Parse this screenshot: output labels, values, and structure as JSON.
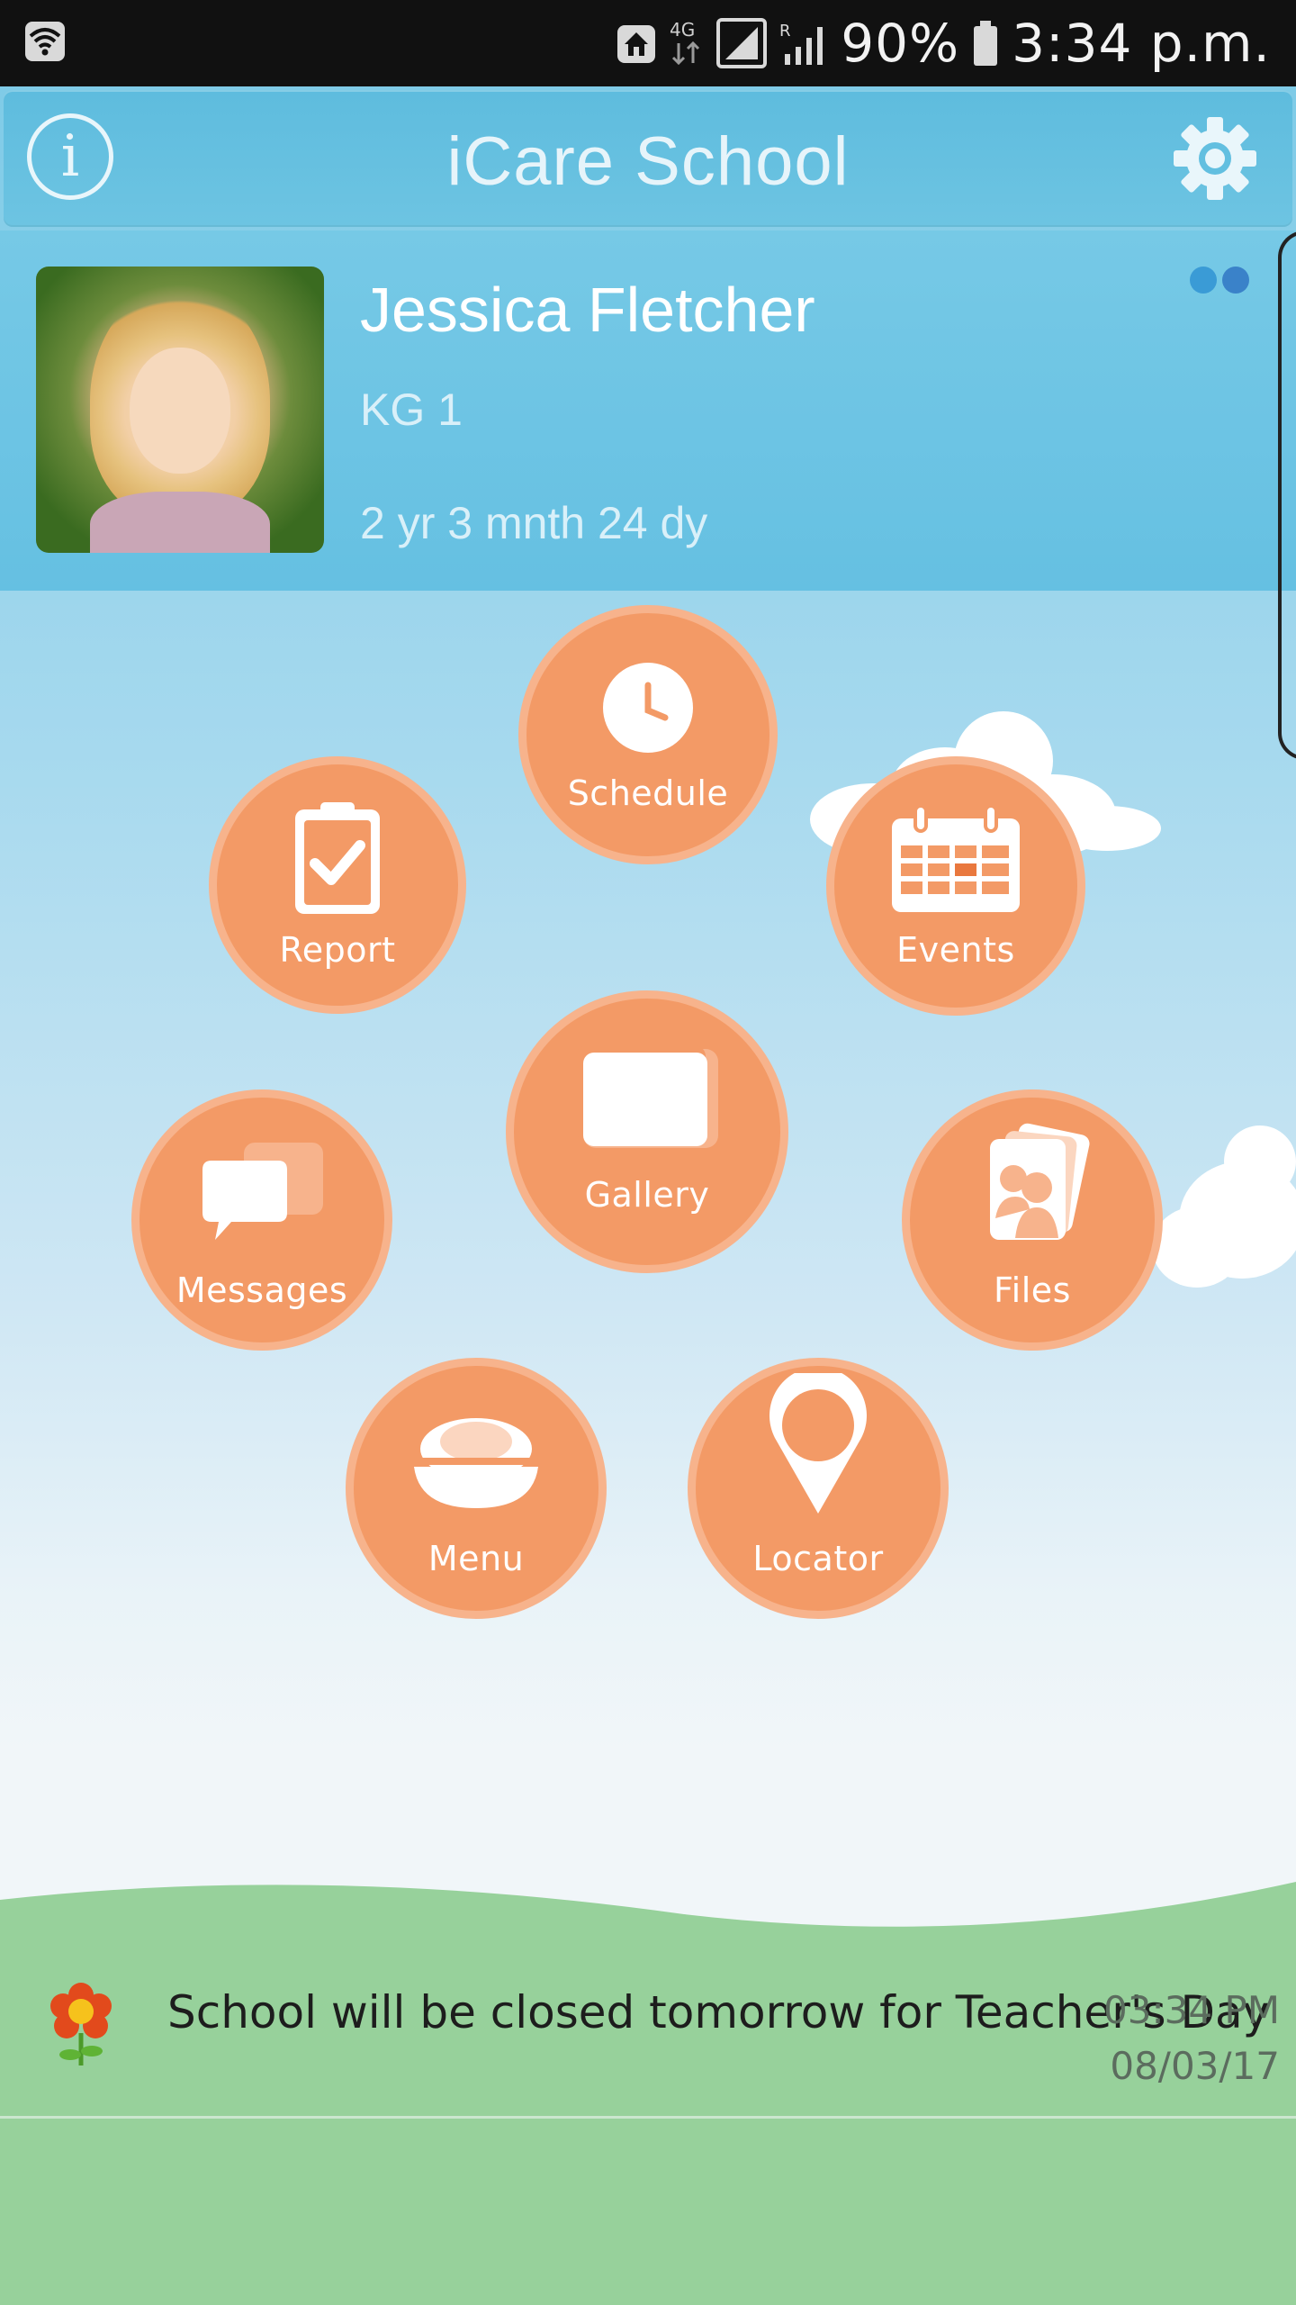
{
  "status_bar": {
    "network": "4G",
    "roaming_indicator": "R",
    "battery": "90%",
    "time": "3:34 p.m.",
    "icons": [
      "wifi-icon",
      "home-icon",
      "4g-icon",
      "signal-icon",
      "roaming-signal-icon",
      "battery-icon"
    ]
  },
  "header": {
    "title": "iCare School",
    "info_label": "i",
    "icons": [
      "info-icon",
      "settings-gear-icon"
    ]
  },
  "profile": {
    "name": "Jessica Fletcher",
    "grade": "KG 1",
    "age": "2 yr 3 mnth 24 dy",
    "page_indicator_dots": 2
  },
  "menu": [
    {
      "id": "schedule",
      "label": "Schedule",
      "icon": "clock-icon"
    },
    {
      "id": "report",
      "label": "Report",
      "icon": "clipboard-check-icon"
    },
    {
      "id": "events",
      "label": "Events",
      "icon": "calendar-icon"
    },
    {
      "id": "gallery",
      "label": "Gallery",
      "icon": "photos-icon"
    },
    {
      "id": "messages",
      "label": "Messages",
      "icon": "chat-bubbles-icon"
    },
    {
      "id": "files",
      "label": "Files",
      "icon": "files-people-icon"
    },
    {
      "id": "menu",
      "label": "Menu",
      "icon": "food-bowl-icon"
    },
    {
      "id": "locator",
      "label": "Locator",
      "icon": "map-pin-icon"
    }
  ],
  "notice": {
    "text": "School will be closed tomorrow for Teacher's Day",
    "time": "03:34 PM",
    "date": "08/03/17",
    "icon": "flower-icon"
  },
  "colors": {
    "header_blue": "#5ebcde",
    "circle_orange": "#f39a66",
    "circle_ring": "#f7b38c",
    "grass_green": "#97d19b"
  }
}
